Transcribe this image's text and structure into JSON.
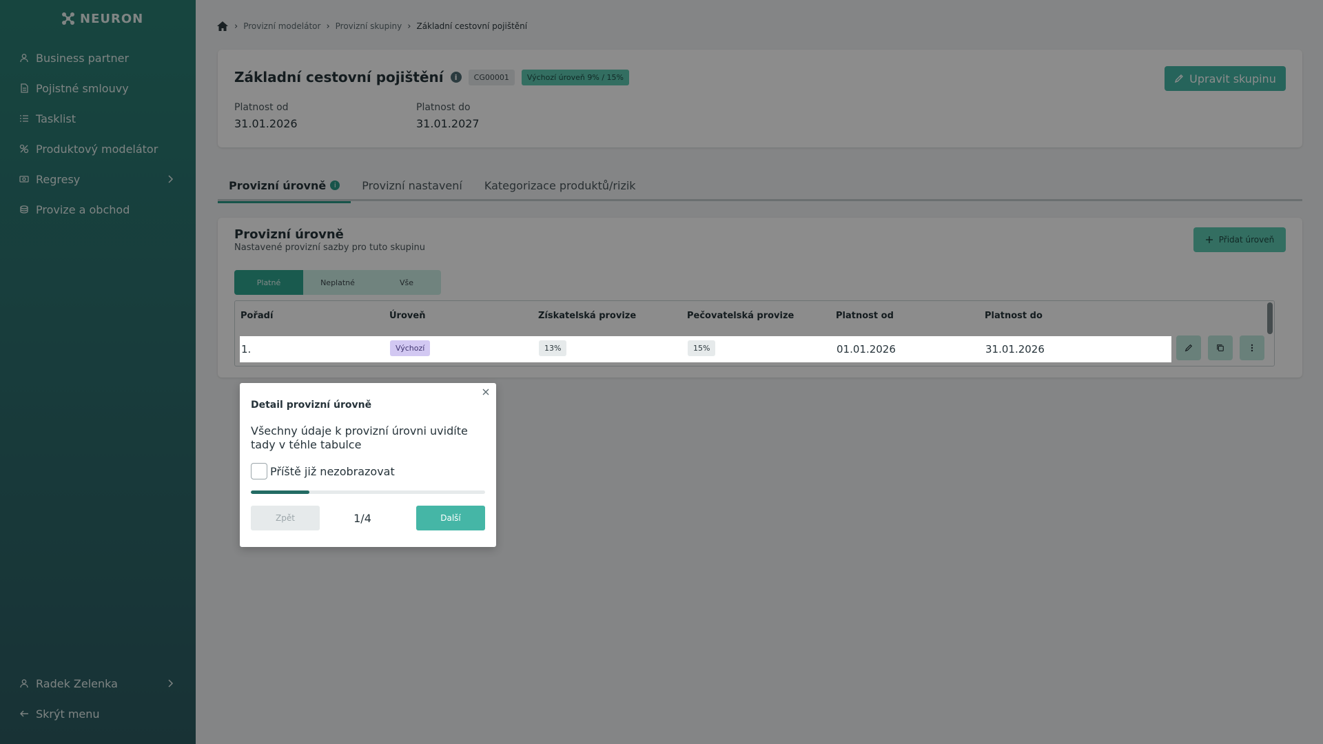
{
  "app": {
    "logo_text": "NEURON"
  },
  "sidebar": {
    "items": [
      {
        "label": "Business partner",
        "icon": "user-icon"
      },
      {
        "label": "Pojistné smlouvy",
        "icon": "document-icon"
      },
      {
        "label": "Tasklist",
        "icon": "list-icon"
      },
      {
        "label": "Produktový modelátor",
        "icon": "tools-icon"
      },
      {
        "label": "Regresy",
        "icon": "money-icon"
      },
      {
        "label": "Provize a obchod",
        "icon": "coins-icon"
      }
    ],
    "user_name": "Radek Zelenka",
    "hide_menu": "Skrýt menu"
  },
  "breadcrumb": {
    "items": [
      "Provizní modelátor",
      "Provizní skupiny"
    ],
    "current": "Základní cestovní pojištění"
  },
  "group": {
    "title": "Základní cestovní pojištění",
    "info_glyph": "i",
    "code": "CG00001",
    "default_level": "Výchozí úroveň 9% / 15%",
    "edit_button": "Upravit skupinu",
    "valid_from_label": "Platnost od",
    "valid_from": "31.01.2026",
    "valid_to_label": "Platnost do",
    "valid_to": "31.01.2027"
  },
  "tabs": [
    {
      "label": "Provizní úrovně",
      "badge": "i",
      "active": true
    },
    {
      "label": "Provizní nastavení"
    },
    {
      "label": "Kategorizace produktů/rizik"
    }
  ],
  "levels": {
    "title": "Provizní úrovně",
    "subtitle": "Nastavené provizní sazby pro tuto skupinu",
    "add_button": "Přidat úroveň",
    "filters": [
      "Platné",
      "Neplatné",
      "Vše"
    ],
    "active_filter": "Platné",
    "columns": [
      "Pořadí",
      "Úroveň",
      "Získatelská provize",
      "Pečovatelská provize",
      "Platnost od",
      "Platnost do"
    ],
    "rows": [
      {
        "order": "1.",
        "level": "Výchozí",
        "acquisition": "13%",
        "care": "15%",
        "valid_from": "01.01.2026",
        "valid_to": "31.01.2026"
      }
    ]
  },
  "popover": {
    "title": "Detail provizní úrovně",
    "text": "Všechny údaje k provizní úrovni uvidíte tady v téhle tabulce",
    "checkbox_label": "Příště již nezobrazovat",
    "progress": 0.25,
    "back": "Zpět",
    "pager": "1/4",
    "next": "Další"
  },
  "colors": {
    "sidebar_top": "#2a7f74",
    "accent": "#45b6a6",
    "tab_active": "#2b9a88",
    "progress": "#236b63"
  }
}
